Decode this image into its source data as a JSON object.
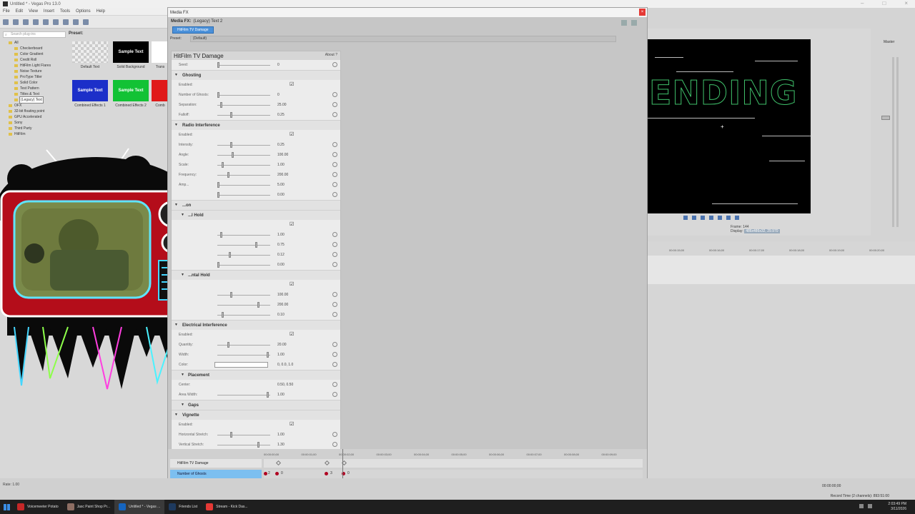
{
  "app": {
    "title": "Untitled * - Vegas Pro 13.0"
  },
  "menu": [
    "File",
    "Edit",
    "View",
    "Insert",
    "Tools",
    "Options",
    "Help"
  ],
  "explorer": {
    "search_placeholder": "Search plug-ins",
    "preset_label": "Preset:",
    "tree": [
      "All",
      "Checkerboard",
      "Color Gradient",
      "Credit Roll",
      "HitFilm Light Flares",
      "Noise Texture",
      "ProType Titler",
      "Solid Color",
      "Test Pattern",
      "Titles & Text",
      "(Legacy) Text",
      "OFX",
      "32-bit floating point",
      "GPU Accelerated",
      "Sony",
      "Third Party",
      "HitFilm"
    ],
    "presets": [
      {
        "thumb": "",
        "label": "Default Text"
      },
      {
        "thumb": "Sample Text",
        "label": "Solid Background"
      },
      {
        "thumb": "",
        "label": "Trans"
      },
      {
        "thumb": "Sample Text",
        "label": "Combined Effects 1"
      },
      {
        "thumb": "Sample Text",
        "label": "Combined Effects 2"
      },
      {
        "thumb": "",
        "label": "Comb"
      }
    ]
  },
  "media_fx": {
    "window_title": "Media FX",
    "chain_label": "Media FX:",
    "chain_value": "(Legacy) Text 2",
    "plugin_tab": "HitFilm TV Damage",
    "preset_label": "Preset:",
    "preset_value": "(Default)",
    "panel_title": "HitFilm TV Damage",
    "about": "About",
    "help": "?",
    "seed": {
      "label": "Seed:",
      "value": "0"
    },
    "ghosting": {
      "title": "Ghosting",
      "rows": [
        {
          "label": "Enabled:",
          "check": true
        },
        {
          "label": "Number of Ghosts:",
          "value": "0",
          "pos": 0.0
        },
        {
          "label": "Separation:",
          "value": "25.00",
          "pos": 0.05
        },
        {
          "label": "Falloff:",
          "value": "0.25",
          "pos": 0.25
        }
      ]
    },
    "radio": {
      "title": "Radio Interference",
      "rows": [
        {
          "label": "Enabled:",
          "check": true
        },
        {
          "label": "Intensity:",
          "value": "0.25",
          "pos": 0.25
        },
        {
          "label": "Angle:",
          "value": "100.00",
          "pos": 0.28
        },
        {
          "label": "Scale:",
          "value": "1.00",
          "pos": 0.08
        },
        {
          "label": "Frequency:",
          "value": "200.00",
          "pos": 0.2
        },
        {
          "label": "Amp...",
          "value": "5.00",
          "pos": 0.0
        },
        {
          "label": "",
          "value": "0.00",
          "pos": 0.0
        }
      ]
    },
    "hold_a": {
      "title": "...on",
      "sub": "...l Hold",
      "rows": [
        {
          "label": "",
          "check": true
        },
        {
          "label": "",
          "value": "1.00",
          "pos": 0.05
        },
        {
          "label": "",
          "value": "0.75",
          "pos": 0.75
        },
        {
          "label": "",
          "value": "0.12",
          "pos": 0.23
        },
        {
          "label": "",
          "value": "0.00",
          "pos": 0.0
        }
      ]
    },
    "hold_b": {
      "title": "...ntal Hold",
      "rows": [
        {
          "label": "",
          "check": true
        },
        {
          "label": "",
          "value": "100.00",
          "pos": 0.25
        },
        {
          "label": "",
          "value": "200.00",
          "pos": 0.8
        },
        {
          "label": "",
          "value": "0.10",
          "pos": 0.08
        }
      ]
    },
    "electrical": {
      "title": "Electrical Interference",
      "rows": [
        {
          "label": "Enabled:",
          "check": true
        },
        {
          "label": "Quantity:",
          "value": "20.00",
          "pos": 0.2
        },
        {
          "label": "Width:",
          "value": "1.00",
          "pos": 0.98
        }
      ],
      "color": {
        "label": "Color:",
        "value": "0, 0.0, 1.0"
      },
      "placement": {
        "title": "Placement",
        "rows": [
          {
            "label": "Center:",
            "value": "0.50, 0.50",
            "pos": -1
          },
          {
            "label": "Area Width:",
            "value": "1.00",
            "pos": 0.98
          }
        ]
      },
      "gaps": "Gaps"
    },
    "vignette": {
      "title": "Vignette",
      "rows": [
        {
          "label": "Enabled:",
          "check": true
        },
        {
          "label": "Horizontal Stretch:",
          "value": "1.00",
          "pos": 0.25
        },
        {
          "label": "Vertical Stretch:",
          "value": "1.30",
          "pos": 0.8
        }
      ]
    },
    "timeline": {
      "ruler": [
        "00:00:00;00",
        "00:00:01;00",
        "00:00:02;00",
        "00:00:03;00",
        "00:00:04;00",
        "00:00:05;00",
        "00:00:06;00",
        "00:00:07;00",
        "00:00:08;00",
        "00:00:09;00"
      ],
      "track1": "HitFilm TV Damage",
      "track2": "Number of Ghosts",
      "kf_values": [
        "2",
        "0",
        "3",
        "0"
      ]
    }
  },
  "preview": {
    "text": "ENDING",
    "frame_label": "Frame:",
    "frame_value": "144",
    "display_label": "Display:",
    "display_value": "486x486x32, 29.970"
  },
  "mixer": {
    "label": "Master"
  },
  "main_timeline": {
    "ruler": [
      "00:00:15;00",
      "00:00:16;00",
      "00:00:17;00",
      "00:00:18;00",
      "00:00:19;00",
      "00:00:20;00"
    ]
  },
  "status": {
    "rate": "Rate: 1.00",
    "timecode": "00:00:00;00",
    "record_time": "Record Time (2 channels): 893:51:00"
  },
  "taskbar": {
    "items": [
      "Voicemeeter Potato",
      "Jasc Paint Shop Pr...",
      "Untitled * - Vegas ...",
      "Friends List",
      "Stream - Kick Das..."
    ],
    "time": "2:03:49 PM",
    "date": "3/11/2026"
  },
  "colors": {
    "accent": "#4a90d9",
    "track_select": "#7cbff0",
    "glow": "#3fc06a"
  }
}
